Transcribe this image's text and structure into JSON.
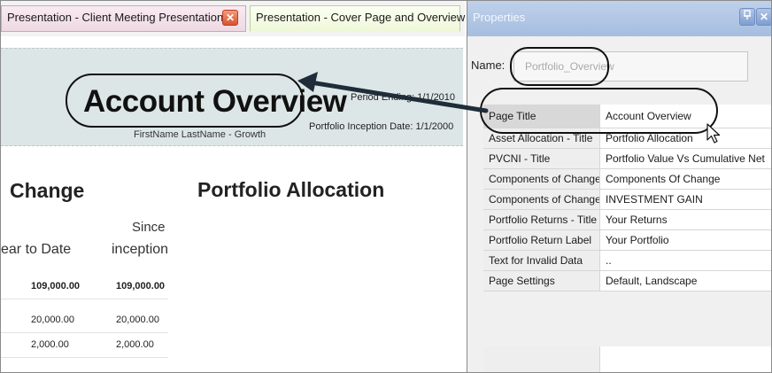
{
  "tabs": [
    {
      "label": "Presentation - Client Meeting Presentation",
      "active": false
    },
    {
      "label": "Presentation - Cover Page and Overview",
      "active": true
    }
  ],
  "document": {
    "title": "Account Overview",
    "client_line": "FirstName LastName - Growth",
    "period_ending": "Period Ending: 1/1/2010",
    "inception_date": "Portfolio Inception Date: 1/1/2000",
    "section_change": "Change",
    "section_allocation": "Portfolio Allocation",
    "columns": {
      "since_line1": "Since",
      "year_to_date": "ear to Date",
      "inception": "inception"
    },
    "rows": [
      {
        "ytd": "109,000.00",
        "since": "109,000.00"
      },
      {
        "ytd": "20,000.00",
        "since": "20,000.00"
      },
      {
        "ytd": "2,000.00",
        "since": "2,000.00"
      }
    ]
  },
  "properties": {
    "title": "Properties",
    "pin_icon": "pin-icon",
    "close_icon": "close-icon",
    "name_label": "Name:",
    "name_value": "Portfolio_Overview",
    "rows": [
      {
        "name": "Page Title",
        "value": "Account Overview"
      },
      {
        "name": "Asset Allocation - Title",
        "value": "Portfolio Allocation"
      },
      {
        "name": "PVCNI - Title",
        "value": "Portfolio Value Vs Cumulative Net"
      },
      {
        "name": "Components of Change",
        "value": "Components Of Change"
      },
      {
        "name": "Components of Change",
        "value": "INVESTMENT GAIN"
      },
      {
        "name": "Portfolio Returns - Title",
        "value": "Your Returns"
      },
      {
        "name": "Portfolio Return Label",
        "value": "Your Portfolio"
      },
      {
        "name": "Text for Invalid Data",
        "value": ".."
      },
      {
        "name": "Page Settings",
        "value": "Default, Landscape"
      }
    ]
  },
  "colors": {
    "header_band": "#dde6e6",
    "props_header": "#a6bde0",
    "active_tab": "#eef8d8",
    "inactive_tab": "#eed9e3",
    "tab_close": "#d9542d"
  }
}
